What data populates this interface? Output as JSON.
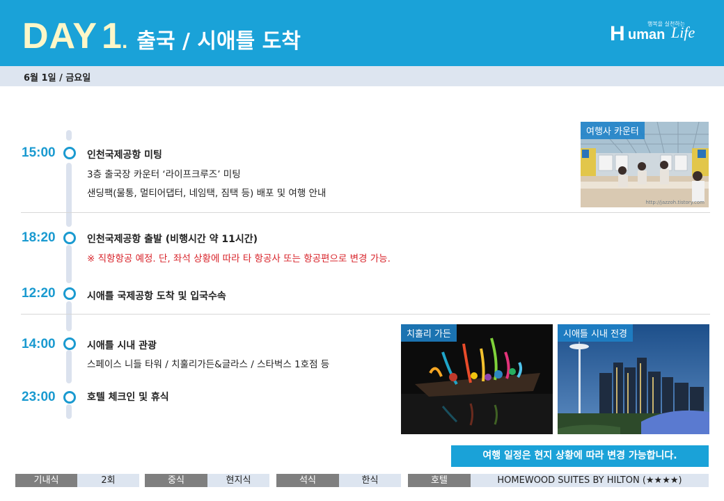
{
  "header": {
    "day_word": "DAY",
    "day_num": "1",
    "day_dot": ".",
    "subtitle": "출국 / 시애틀 도착",
    "logo": {
      "tagline": "행복을 실천하는",
      "h": "H",
      "uman": "uman",
      "life": "Life"
    }
  },
  "date": "6월 1일 / 금요일",
  "schedule": [
    {
      "time": "15:00",
      "title": "인천국제공항 미팅",
      "lines": [
        "3층 출국장 카운터 ‘라이프크루즈’ 미팅",
        "샌딩팩(물통, 멀티어댑터, 네임택, 짐택 등) 배포 및 여행 안내"
      ]
    },
    {
      "time": "18:20",
      "title": "인천국제공항 출발 (비행시간 약 11시간)",
      "warning": "※ 직항항공 예정. 단, 좌석 상황에 따라 타 항공사 또는 항공편으로 변경 가능."
    },
    {
      "time": "12:20",
      "title": "시애틀 국제공항 도착 및 입국수속"
    },
    {
      "time": "14:00",
      "title": "시애틀 시내 관광",
      "lines": [
        "스페이스 니들 타워 / 치훌리가든&글라스 / 스타벅스 1호점 등"
      ]
    },
    {
      "time": "23:00",
      "title": "호텔 체크인 및 휴식"
    }
  ],
  "photos": {
    "counter": {
      "label": "여행사 카운터",
      "watermark": "http://jazzoh.tistory.com"
    },
    "chihuly": {
      "label": "치훌리 가든"
    },
    "seattle": {
      "label": "시애틀 시내 전경"
    }
  },
  "notice": "여행 일정은 현지 상황에 따라 변경 가능합니다.",
  "footer": {
    "items": [
      {
        "key": "기내식",
        "value": "2회"
      },
      {
        "key": "중식",
        "value": "현지식"
      },
      {
        "key": "석식",
        "value": "한식"
      },
      {
        "key": "호텔",
        "value": "HOMEWOOD SUITES BY HILTON (★★★★)"
      }
    ]
  },
  "colors": {
    "header_bg": "#1aa2d8",
    "accent": "#1a9ad0",
    "warning": "#d8232a",
    "datebar_bg": "#dde5f0",
    "footer_key_bg": "#7f7f7f"
  }
}
